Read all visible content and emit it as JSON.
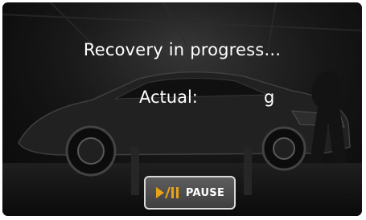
{
  "screen": {
    "status": "Recovery in progress...",
    "actual_label": "Actual:",
    "actual_value": "",
    "actual_unit": "g",
    "background": "car-workshop-photo"
  },
  "controls": {
    "pause_label": "PAUSE",
    "pause_icon": "play-pause-icon",
    "icon_color": "#e8a21a"
  }
}
